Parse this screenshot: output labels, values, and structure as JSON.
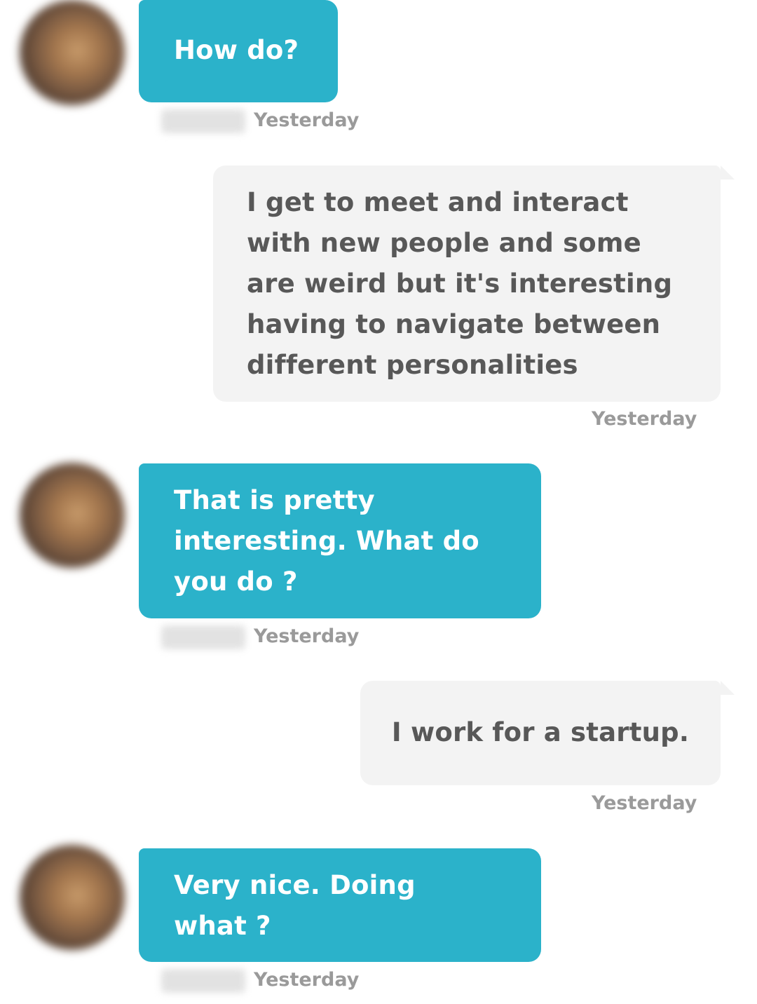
{
  "messages": [
    {
      "direction": "incoming",
      "lines": [
        "How do?"
      ],
      "time": "Yesterday"
    },
    {
      "direction": "outgoing",
      "lines": [
        "I get to meet and interact",
        "with new people and some",
        "are weird but it's interesting",
        "having to navigate between",
        "different personalities"
      ],
      "time": "Yesterday"
    },
    {
      "direction": "incoming",
      "lines": [
        "That is pretty",
        "interesting. What do",
        "you do ?"
      ],
      "time": "Yesterday"
    },
    {
      "direction": "outgoing",
      "lines": [
        "I work for a startup."
      ],
      "time": "Yesterday"
    },
    {
      "direction": "incoming",
      "lines": [
        "Very nice. Doing",
        "what ?"
      ],
      "time": "Yesterday"
    }
  ],
  "colors": {
    "incoming_bubble": "#2bb2ca",
    "outgoing_bubble": "#f3f3f3",
    "outgoing_text": "#585858",
    "timestamp": "#9a9a9a"
  }
}
